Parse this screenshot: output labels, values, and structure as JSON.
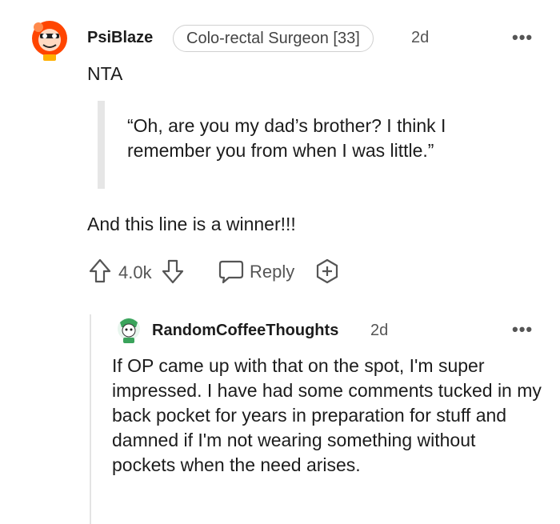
{
  "comment": {
    "username": "PsiBlaze",
    "flair": "Colo-rectal Surgeon [33]",
    "time": "2d",
    "more": "•••",
    "line1": "NTA",
    "quote": "“Oh, are you my dad’s brother? I think I remember you from when I was little.”",
    "line2": "And this line is a winner!!!",
    "votes": "4.0k",
    "reply_label": "Reply",
    "icons": [
      "upvote-icon",
      "downvote-icon",
      "reply-icon",
      "award-icon"
    ]
  },
  "reply": {
    "username": "RandomCoffeeThoughts",
    "time": "2d",
    "more": "•••",
    "text": "If OP came up with that on the spot, I'm super impressed. I have had some comments tucked in my back pocket for years in preparation for stuff and damned if I'm not wearing something without pockets when the need arises."
  }
}
